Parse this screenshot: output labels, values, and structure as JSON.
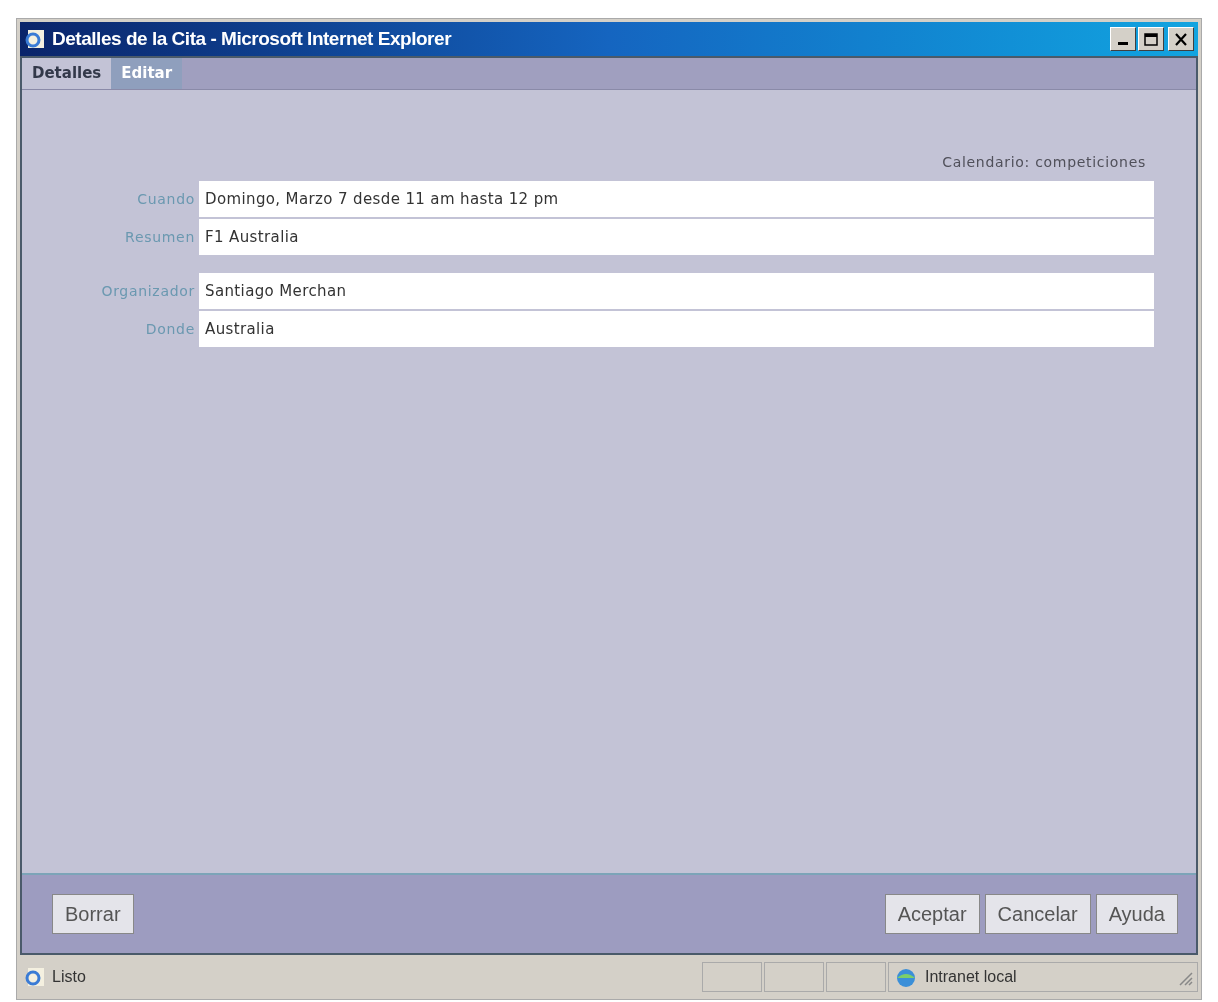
{
  "window": {
    "title": "Detalles de la Cita - Microsoft Internet Explorer"
  },
  "tabs": [
    {
      "label": "Detalles",
      "selected": true
    },
    {
      "label": "Editar",
      "selected": false
    }
  ],
  "calendar_label": "Calendario: competiciones",
  "field_groups": [
    [
      {
        "label": "Cuando",
        "value": "Domingo, Marzo 7 desde 11 am hasta 12 pm"
      },
      {
        "label": "Resumen",
        "value": "F1 Australia"
      }
    ],
    [
      {
        "label": "Organizador",
        "value": "Santiago Merchan"
      },
      {
        "label": "Donde",
        "value": "Australia"
      }
    ]
  ],
  "left_buttons": [
    "Borrar"
  ],
  "right_buttons": [
    "Aceptar",
    "Cancelar",
    "Ayuda"
  ],
  "status_bar": {
    "text": "Listo",
    "zone": "Intranet local"
  }
}
